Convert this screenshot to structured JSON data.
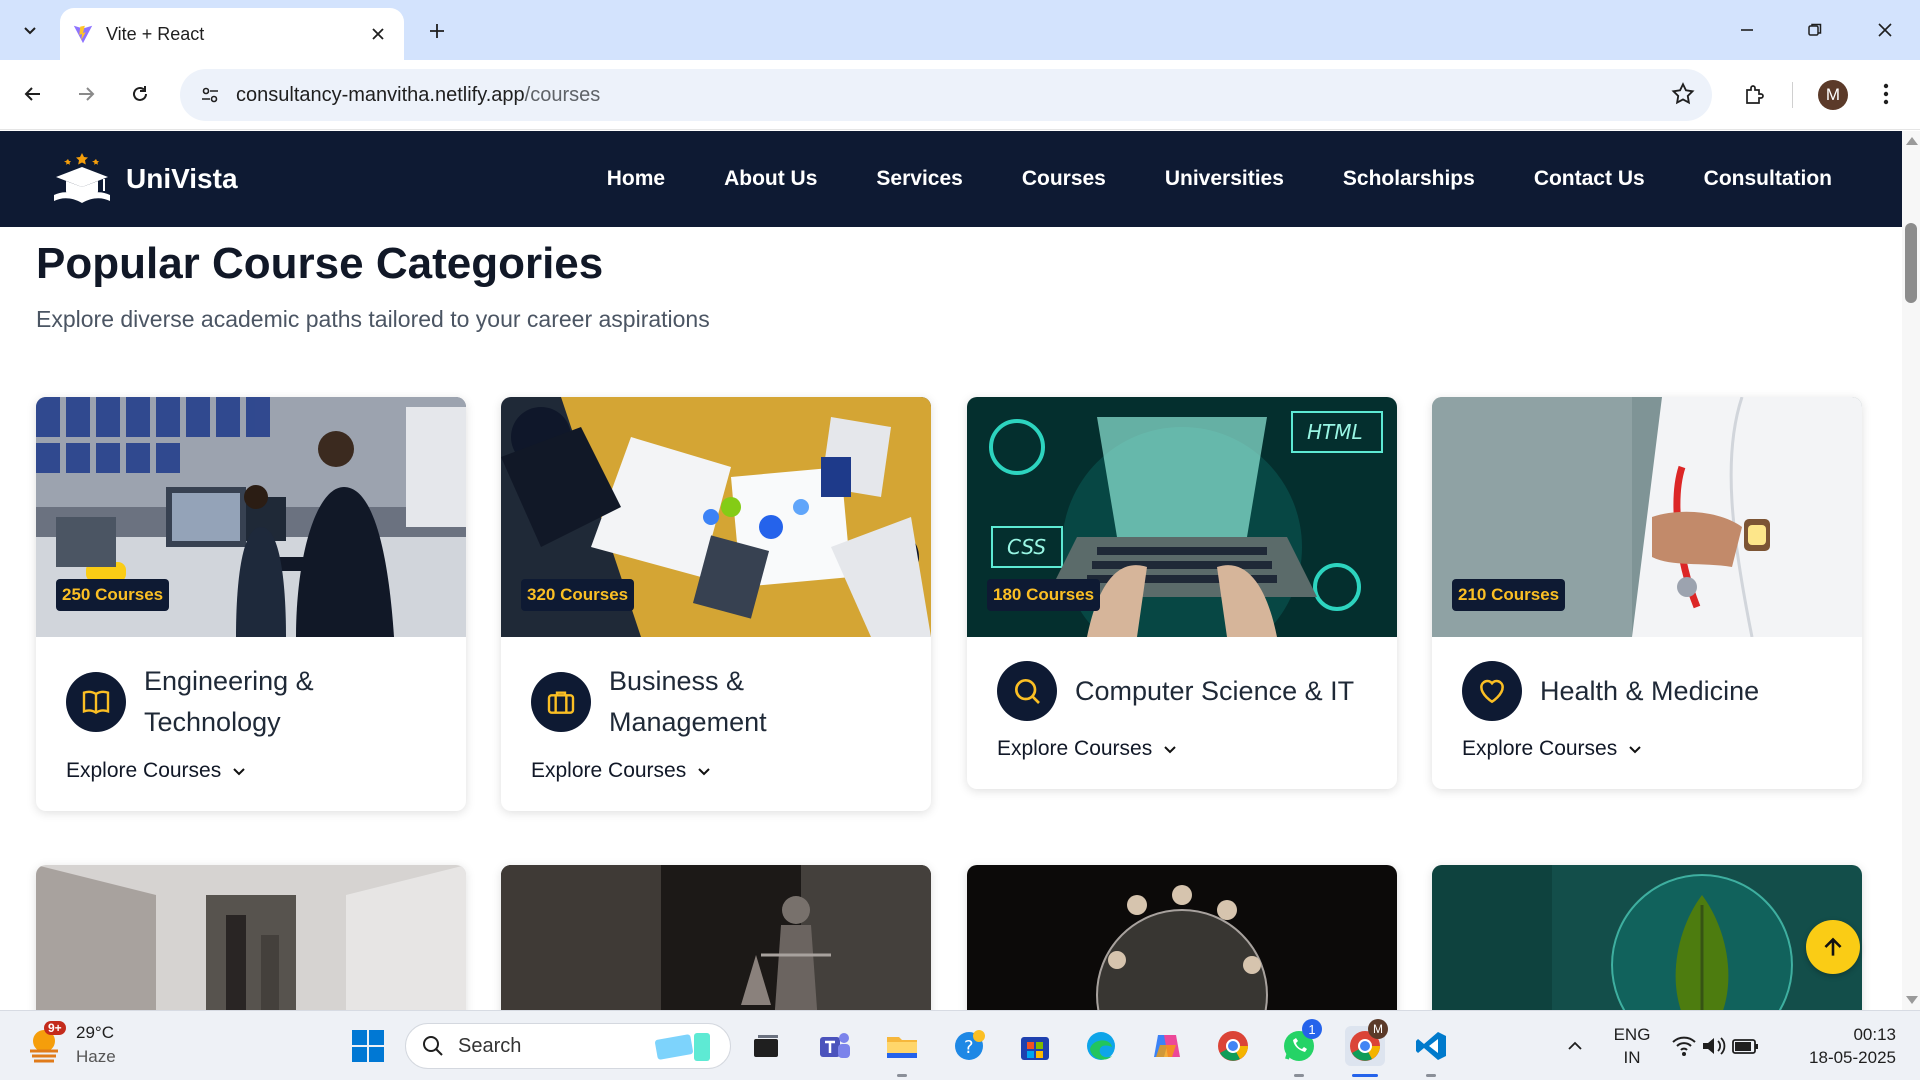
{
  "browser": {
    "tab_title": "Vite + React",
    "url_host": "consultancy-manvitha.netlify.app",
    "url_path": "/courses",
    "profile_initial": "M"
  },
  "site": {
    "brand": "UniVista",
    "nav": [
      "Home",
      "About Us",
      "Services",
      "Courses",
      "Universities",
      "Scholarships",
      "Contact Us",
      "Consultation"
    ]
  },
  "page": {
    "title": "Popular Course Categories",
    "subtitle": "Explore diverse academic paths tailored to your career aspirations"
  },
  "categories": [
    {
      "badge": "250 Courses",
      "title": "Engineering & Technology",
      "icon": "book-icon",
      "explore": "Explore Courses"
    },
    {
      "badge": "320 Courses",
      "title": "Business & Management",
      "icon": "briefcase-icon",
      "explore": "Explore Courses"
    },
    {
      "badge": "180 Courses",
      "title": "Computer Science & IT",
      "icon": "search-icon",
      "explore": "Explore Courses"
    },
    {
      "badge": "210 Courses",
      "title": "Health & Medicine",
      "icon": "heart-icon",
      "explore": "Explore Courses"
    }
  ],
  "image_text": {
    "html": "HTML",
    "css": "CSS"
  },
  "taskbar": {
    "temperature": "29°C",
    "condition": "Haze",
    "weather_badge": "9+",
    "search_placeholder": "Search",
    "whatsapp_badge": "1",
    "chrome_badge": "M",
    "lang_top": "ENG",
    "lang_bottom": "IN",
    "time": "00:13",
    "date": "18-05-2025"
  },
  "colors": {
    "navy": "#0e1a33",
    "accent_yellow": "#facc15",
    "badge_text": "#fbbf24"
  }
}
